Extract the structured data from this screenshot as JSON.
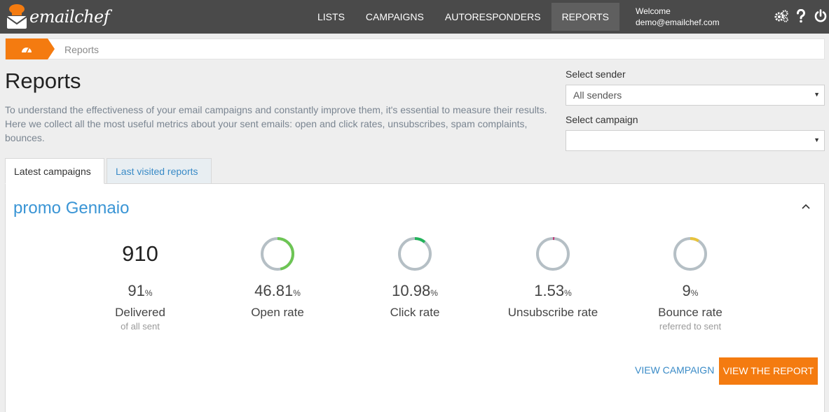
{
  "brand": {
    "name": "emailchef",
    "accent": "#f47b10",
    "link": "#3a95d5"
  },
  "nav": {
    "items": [
      {
        "label": "LISTS",
        "active": false
      },
      {
        "label": "CAMPAIGNS",
        "active": false
      },
      {
        "label": "AUTORESPONDERS",
        "active": false
      },
      {
        "label": "REPORTS",
        "active": true
      }
    ],
    "welcome": "Welcome",
    "user": "demo@emailchef.com",
    "icons": [
      "settings-gears-icon",
      "help-icon",
      "power-icon"
    ]
  },
  "breadcrumb": {
    "home_icon": "dashboard-icon",
    "current": "Reports"
  },
  "header": {
    "title": "Reports",
    "description": "To understand the effectiveness of your email campaigns and constantly improve them, it's essential to measure their results. Here we collect all the most useful metrics about your sent emails: open and click rates, unsubscribes, spam complaints, bounces."
  },
  "filters": {
    "sender_label": "Select sender",
    "sender_value": "All senders",
    "campaign_label": "Select campaign",
    "campaign_value": ""
  },
  "tabs": [
    {
      "label": "Latest campaigns",
      "active": true
    },
    {
      "label": "Last visited reports",
      "active": false
    }
  ],
  "campaign": {
    "title": "promo Gennaio",
    "stats": [
      {
        "big": "910",
        "value": "91",
        "unit": "%",
        "label": "Delivered",
        "sub": "of all sent"
      },
      {
        "value": "46.81",
        "unit": "%",
        "label": "Open rate",
        "sub": "",
        "ring_fraction": 0.4681,
        "ring_color": "#6dc554"
      },
      {
        "value": "10.98",
        "unit": "%",
        "label": "Click rate",
        "sub": "",
        "ring_fraction": 0.1098,
        "ring_color": "#22b35a"
      },
      {
        "value": "1.53",
        "unit": "%",
        "label": "Unsubscribe rate",
        "sub": "",
        "ring_fraction": 0.0153,
        "ring_color": "#c0397a"
      },
      {
        "value": "9",
        "unit": "%",
        "label": "Bounce rate",
        "sub": "referred to sent",
        "ring_fraction": 0.09,
        "ring_color": "#e8c33b"
      }
    ],
    "view_campaign": "VIEW CAMPAIGN",
    "view_report": "VIEW THE REPORT"
  }
}
